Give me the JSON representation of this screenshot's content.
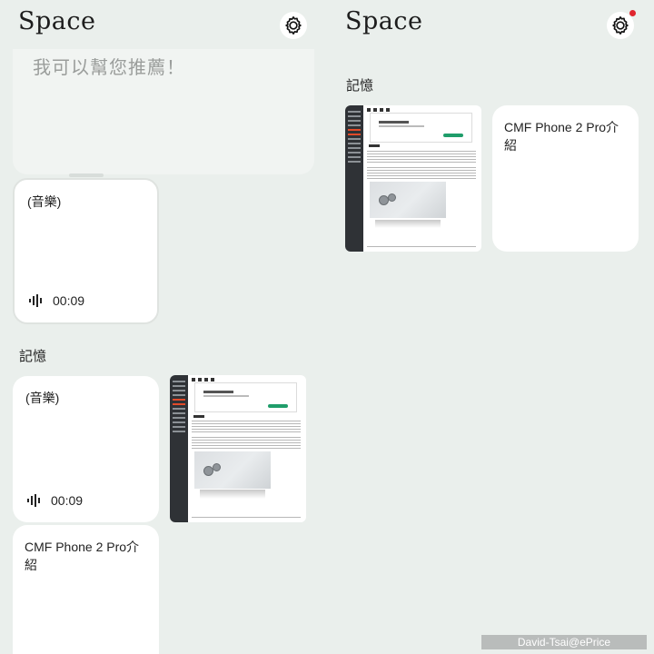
{
  "left": {
    "app_title": "Space",
    "suggest_text": "我可以幫您推薦！",
    "audio_card": {
      "title": "(音樂)",
      "duration": "00:09"
    },
    "section_label": "記憶",
    "memory_audio_card": {
      "title": "(音樂)",
      "duration": "00:09"
    },
    "memory_note_card": {
      "title": "CMF Phone 2 Pro介紹"
    }
  },
  "right": {
    "app_title": "Space",
    "section_label": "記憶",
    "memory_note_card": {
      "title": "CMF Phone 2 Pro介紹"
    }
  },
  "icons": {
    "settings": "gear-icon",
    "audio": "waveform-icon",
    "notification": "red-dot"
  },
  "colors": {
    "background": "#eaefec",
    "card": "#ffffff",
    "notification_dot": "#e0252e"
  },
  "watermark": "David-Tsai@ePrice"
}
